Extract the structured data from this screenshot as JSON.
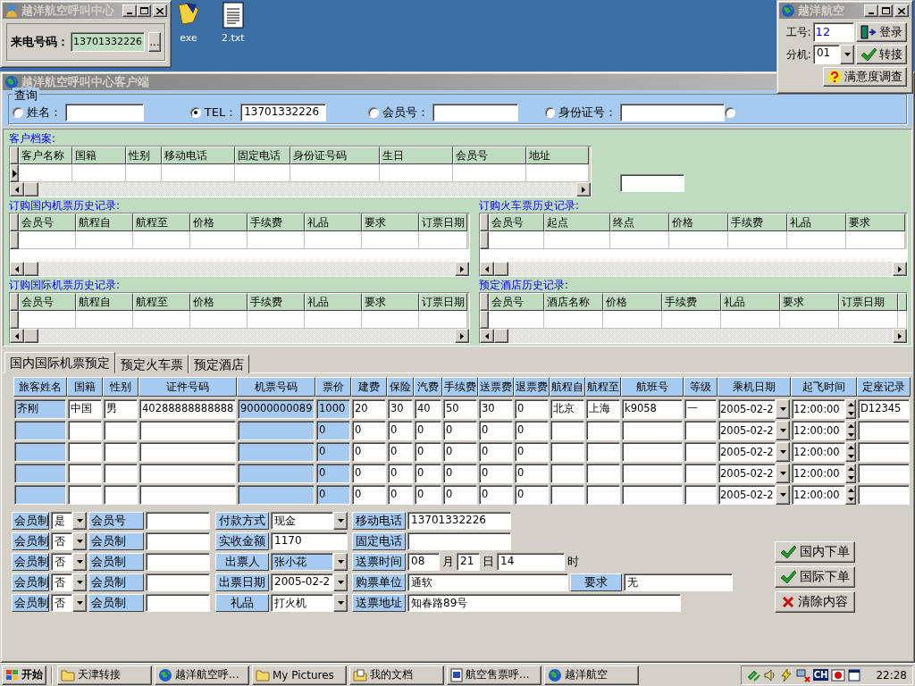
{
  "desktop_icons": [
    {
      "label": "exe",
      "kind": "app"
    },
    {
      "label": "2.txt",
      "kind": "text"
    }
  ],
  "caller_window": {
    "title": "越洋航空呼叫中心",
    "label": "来电号码：",
    "value": "13701332226",
    "button": "..."
  },
  "agent_window": {
    "title": "越洋航空",
    "id_label": "工号:",
    "id_value": "12",
    "login_button": "登录",
    "ext_label": "分机:",
    "ext_value": "01",
    "transfer_button": "转接",
    "survey_button": "满意度调查"
  },
  "main_window": {
    "title": "越洋航空呼叫中心客户端"
  },
  "query": {
    "legend": "查询",
    "options": [
      {
        "label": "姓名：",
        "selected": false
      },
      {
        "label": "TEL：",
        "value": "13701332226",
        "selected": true
      },
      {
        "label": "会员号：",
        "selected": false
      },
      {
        "label": "身份证号：",
        "selected": false
      },
      {
        "selected": false
      }
    ]
  },
  "customer_grid": {
    "title": "客户档案:",
    "columns": [
      "客户名称",
      "国籍",
      "性别",
      "移动电话",
      "固定电话",
      "身份证号码",
      "生日",
      "会员号",
      "地址"
    ]
  },
  "history_grids": [
    {
      "title": "订购国内机票历史记录:",
      "columns": [
        "会员号",
        "航程自",
        "航程至",
        "价格",
        "手续费",
        "礼品",
        "要求",
        "订票日期"
      ]
    },
    {
      "title": "订购火车票历史记录:",
      "columns": [
        "会员号",
        "起点",
        "终点",
        "价格",
        "手续费",
        "礼品",
        "要求"
      ]
    },
    {
      "title": "订购国际机票历史记录:",
      "columns": [
        "会员号",
        "航程自",
        "航程至",
        "价格",
        "手续费",
        "礼品",
        "要求",
        "订票日期"
      ]
    },
    {
      "title": "预定酒店历史记录:",
      "columns": [
        "会员号",
        "酒店名称",
        "价格",
        "手续费",
        "礼品",
        "要求",
        "订票日期"
      ]
    }
  ],
  "tabs": [
    {
      "label": "国内国际机票预定",
      "selected": true
    },
    {
      "label": "预定火车票",
      "selected": false
    },
    {
      "label": "预定酒店",
      "selected": false
    }
  ],
  "booking_table": {
    "columns": [
      {
        "label": "旅客姓名",
        "kind": "shaded"
      },
      {
        "label": "国籍",
        "kind": "text"
      },
      {
        "label": "性别",
        "kind": "text"
      },
      {
        "label": "证件号码",
        "kind": "text"
      },
      {
        "label": "机票号码",
        "kind": "shaded"
      },
      {
        "label": "票价",
        "kind": "shaded"
      },
      {
        "label": "建费",
        "kind": "text"
      },
      {
        "label": "保险",
        "kind": "text"
      },
      {
        "label": "汽费",
        "kind": "text"
      },
      {
        "label": "手续费",
        "kind": "text"
      },
      {
        "label": "送票费",
        "kind": "text"
      },
      {
        "label": "退票费",
        "kind": "text"
      },
      {
        "label": "航程自",
        "kind": "text"
      },
      {
        "label": "航程至",
        "kind": "text"
      },
      {
        "label": "航班号",
        "kind": "text"
      },
      {
        "label": "等级",
        "kind": "text"
      },
      {
        "label": "乘机日期",
        "kind": "combo"
      },
      {
        "label": "起飞时间",
        "kind": "spin"
      },
      {
        "label": "定座记录",
        "kind": "text"
      }
    ],
    "rows": [
      [
        "齐刚",
        "中国",
        "男",
        "40288888888888",
        "90000000089",
        "1000",
        "20",
        "30",
        "40",
        "50",
        "30",
        "0",
        "北京",
        "上海",
        "k9058",
        "一",
        "2005-02-2",
        "12:00:00",
        "D12345"
      ],
      [
        null,
        null,
        null,
        null,
        null,
        "0",
        "0",
        "0",
        "0",
        "0",
        "0",
        "0",
        null,
        null,
        null,
        null,
        "2005-02-2",
        "12:00:00",
        null
      ],
      [
        null,
        null,
        null,
        null,
        null,
        "0",
        "0",
        "0",
        "0",
        "0",
        "0",
        "0",
        null,
        null,
        null,
        null,
        "2005-02-2",
        "12:00:00",
        null
      ],
      [
        null,
        null,
        null,
        null,
        null,
        "0",
        "0",
        "0",
        "0",
        "0",
        "0",
        "0",
        null,
        null,
        null,
        null,
        "2005-02-2",
        "12:00:00",
        null
      ],
      [
        null,
        null,
        null,
        null,
        null,
        "0",
        "0",
        "0",
        "0",
        "0",
        "0",
        "0",
        null,
        null,
        null,
        null,
        "2005-02-2",
        "12:00:00",
        null
      ]
    ]
  },
  "member_rows": [
    {
      "label": "会员制",
      "value": "是",
      "field_label": "会员号"
    },
    {
      "label": "会员制",
      "value": "否",
      "field_label": "会员制"
    },
    {
      "label": "会员制",
      "value": "否",
      "field_label": "会员制"
    },
    {
      "label": "会员制",
      "value": "否",
      "field_label": "会员制"
    },
    {
      "label": "会员制",
      "value": "否",
      "field_label": "会员制"
    }
  ],
  "payment_rows": [
    {
      "label": "付款方式",
      "kind": "combo",
      "value": "现金",
      "selected": false
    },
    {
      "label": "实收金额",
      "kind": "text",
      "value": "1170",
      "selected": false
    },
    {
      "label": "出票人",
      "kind": "combo",
      "value": "张小花",
      "selected": true
    },
    {
      "label": "出票日期",
      "kind": "combo",
      "value": "2005-02-2",
      "selected": false
    },
    {
      "label": "礼品",
      "kind": "combo",
      "value": "打火机",
      "selected": false
    }
  ],
  "delivery_rows": [
    {
      "label": "移动电话",
      "parts": [
        {
          "kind": "field",
          "value": "13701332226"
        }
      ]
    },
    {
      "label": "固定电话",
      "parts": [
        {
          "kind": "field"
        }
      ]
    },
    {
      "label": "送票时间",
      "parts": [
        {
          "kind": "field",
          "value": "08"
        },
        {
          "kind": "unit",
          "text": "月"
        },
        {
          "kind": "field",
          "value": "21"
        },
        {
          "kind": "unit",
          "text": "日"
        },
        {
          "kind": "field",
          "value": "14"
        },
        {
          "kind": "unit",
          "text": "时"
        }
      ]
    },
    {
      "label": "购票单位",
      "parts": [
        {
          "kind": "field",
          "value": "通软"
        },
        {
          "kind": "label",
          "text": "要求"
        },
        {
          "kind": "field",
          "value": "无"
        }
      ]
    },
    {
      "label": "送票地址",
      "parts": [
        {
          "kind": "field",
          "value": "知春路89号"
        }
      ]
    }
  ],
  "actions": [
    {
      "label": "国内下单",
      "kind": "check"
    },
    {
      "label": "国际下单",
      "kind": "check"
    },
    {
      "label": "清除内容",
      "kind": "clear"
    }
  ],
  "taskbar": {
    "start": "开始",
    "tasks": [
      {
        "label": "天津转接",
        "kind": "folder"
      },
      {
        "label": "越洋航空呼...",
        "kind": "globe"
      },
      {
        "label": "My Pictures",
        "kind": "folder"
      },
      {
        "label": "我的文档",
        "kind": "docs"
      },
      {
        "label": "航空售票呼...",
        "kind": "word"
      },
      {
        "label": "越洋航空",
        "kind": "globe"
      }
    ],
    "language": "CH",
    "clock": "22:28"
  }
}
